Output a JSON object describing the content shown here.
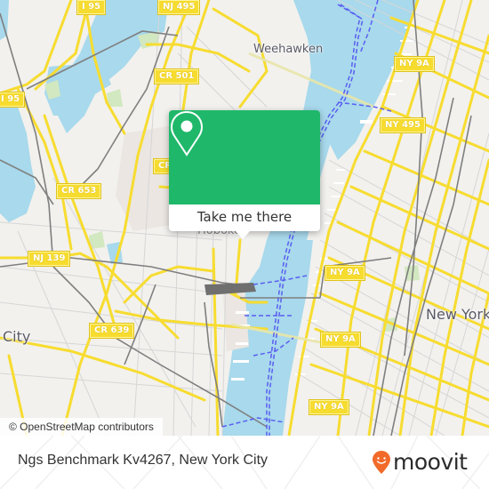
{
  "map": {
    "attribution": "© OpenStreetMap contributors",
    "colors": {
      "land": "#f2f1ee",
      "water": "#a8d9ec",
      "road_major": "#f7dc30",
      "road_minor": "#d4d4d4",
      "rail": "#7a7a7a",
      "ferry": "#5a5ef0",
      "park": "#d2e8c0"
    },
    "places": [
      {
        "name": "Weehawken",
        "size": "small"
      },
      {
        "name": "New York",
        "size": "large"
      },
      {
        "name": "City",
        "size": "large"
      },
      {
        "name": "Hoboken",
        "size": "small"
      }
    ],
    "shields": [
      {
        "label": "I 95"
      },
      {
        "label": "NJ 495"
      },
      {
        "label": "CR 501"
      },
      {
        "label": "I 95"
      },
      {
        "label": "CR 653"
      },
      {
        "label": "CR"
      },
      {
        "label": "NY 9A"
      },
      {
        "label": "NY 495"
      },
      {
        "label": "NJ 139"
      },
      {
        "label": "CR 639"
      },
      {
        "label": "NY 9A"
      },
      {
        "label": "NY 9A"
      },
      {
        "label": "NY 9A"
      }
    ]
  },
  "popup": {
    "icon": "map-pin-icon",
    "cta_label": "Take me there",
    "color": "#1fb86a"
  },
  "footer": {
    "place_title": "Ngs Benchmark Kv4267, New York City",
    "brand": {
      "name": "moovit",
      "logo_icon": "moovit-smiley-pin-icon",
      "logo_color": "#f26a2a"
    }
  }
}
